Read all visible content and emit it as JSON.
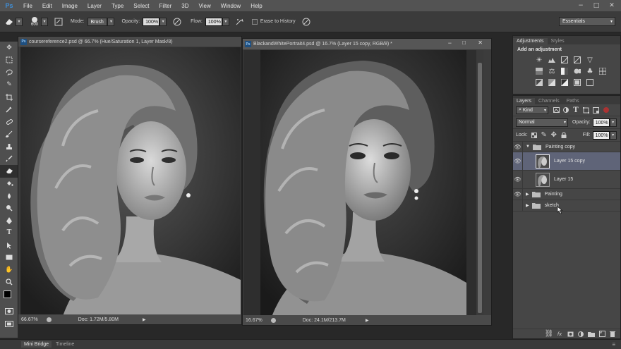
{
  "menubar": {
    "logo": "Ps",
    "items": [
      "File",
      "Edit",
      "Image",
      "Layer",
      "Type",
      "Select",
      "Filter",
      "3D",
      "View",
      "Window",
      "Help"
    ],
    "minimize": "−",
    "maximize": "□",
    "close": "✕"
  },
  "options": {
    "brush_size": "600",
    "mode_label": "Mode:",
    "mode_value": "Brush",
    "opacity_label": "Opacity:",
    "opacity_value": "100%",
    "flow_label": "Flow:",
    "flow_value": "100%",
    "erase_history": "Erase to History",
    "workspace": "Essentials"
  },
  "doc1": {
    "title": "coursereference2.psd @ 66.7% (Hue/Saturation 1, Layer Mask/8)",
    "zoom": "66.67%",
    "doc_info": "Doc: 1.72M/5.80M"
  },
  "doc2": {
    "title": "BlackandWhitePortrait4.psd @ 16.7% (Layer 15 copy, RGB/8) *",
    "zoom": "16.67%",
    "doc_info": "Doc: 24.1M/213.7M"
  },
  "adjustments": {
    "tabs": [
      "Adjustments",
      "Styles"
    ],
    "heading": "Add an adjustment"
  },
  "layers": {
    "tabs": [
      "Layers",
      "Channels",
      "Paths"
    ],
    "filter_kind": "Kind",
    "blend_mode": "Normal",
    "opacity_label": "Opacity:",
    "opacity_value": "100%",
    "lock_label": "Lock:",
    "fill_label": "Fill:",
    "fill_value": "100%",
    "rows": [
      {
        "name": "Painting copy"
      },
      {
        "name": "Layer 15 copy"
      },
      {
        "name": "Layer 15"
      },
      {
        "name": "Painting"
      },
      {
        "name": "sketch"
      }
    ]
  },
  "bottom": {
    "tabs": [
      "Mini Bridge",
      "Timeline"
    ]
  }
}
